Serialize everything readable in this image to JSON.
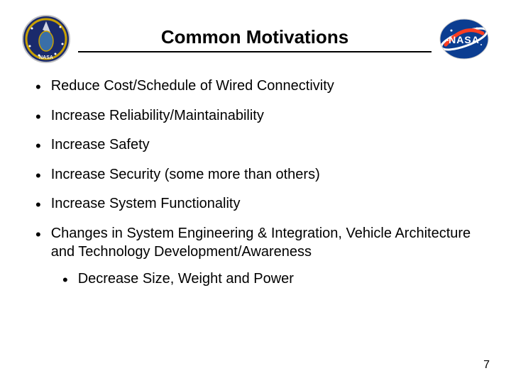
{
  "header": {
    "title": "Common Motivations"
  },
  "bullets": [
    "Reduce Cost/Schedule of Wired Connectivity",
    "Increase Reliability/Maintainability",
    "Increase Safety",
    "Increase Security (some more than others)",
    "Increase System Functionality",
    "Changes in System Engineering & Integration, Vehicle Architecture and Technology Development/Awareness"
  ],
  "sub_bullet": "Decrease Size, Weight and Power",
  "page_number": "7"
}
